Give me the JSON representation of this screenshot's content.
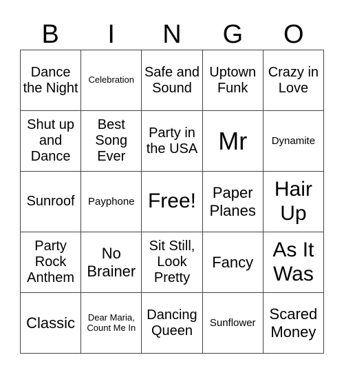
{
  "header": {
    "letters": [
      "B",
      "I",
      "N",
      "G",
      "O"
    ]
  },
  "cells": [
    [
      "Dance the Night",
      "Celebration",
      "Safe and Sound",
      "Uptown Funk",
      "Crazy in Love"
    ],
    [
      "Shut up and Dance",
      "Best Song Ever",
      "Party in the USA",
      "Mr",
      "Dynamite"
    ],
    [
      "Sunroof",
      "Payphone",
      "Free!",
      "Paper Planes",
      "Hair Up"
    ],
    [
      "Party Rock Anthem",
      "No Brainer",
      "Sit Still, Look Pretty",
      "Fancy",
      "As It Was"
    ],
    [
      "Classic",
      "Dear Maria, Count Me In",
      "Dancing Queen",
      "Sunflower",
      "Scared Money"
    ]
  ],
  "free_space": {
    "label": "Free!",
    "row": 2,
    "col": 2
  }
}
